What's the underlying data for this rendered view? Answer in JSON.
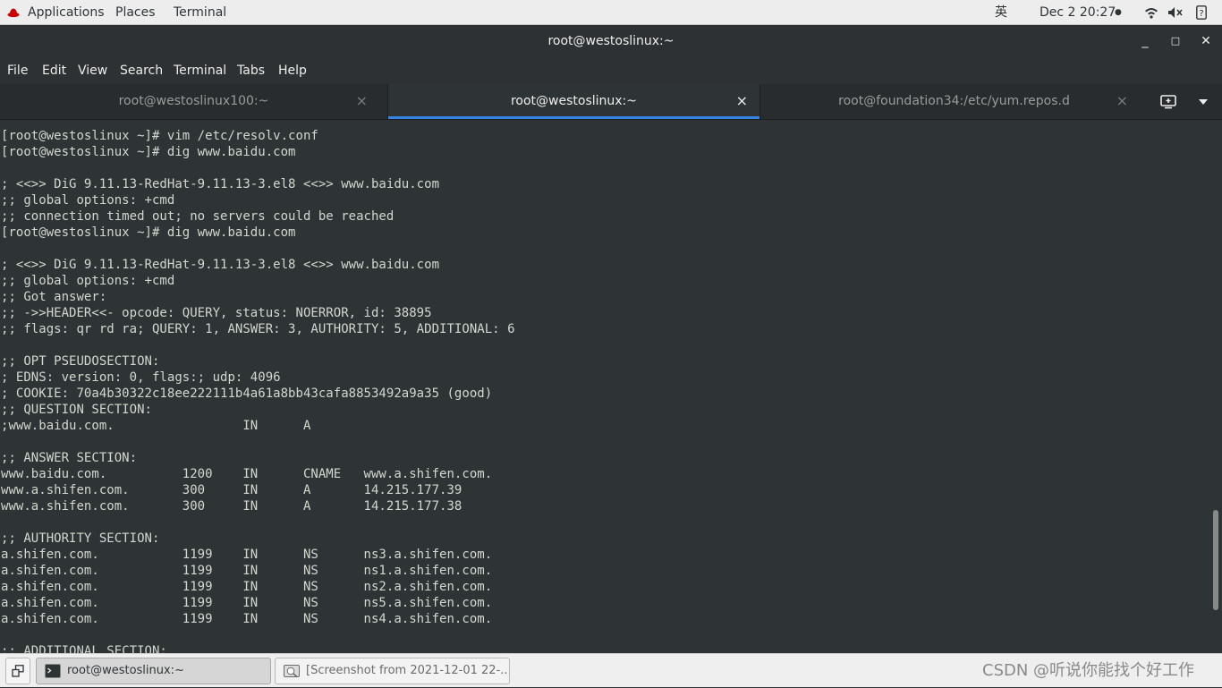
{
  "top_panel": {
    "applications": "Applications",
    "places": "Places",
    "terminal": "Terminal",
    "input_method": "英",
    "clock": "Dec 2  20:27",
    "icons": [
      "redhat-icon",
      "wifi-icon",
      "volume-icon",
      "power-icon"
    ]
  },
  "window": {
    "title": "root@westoslinux:~",
    "minimize": "_",
    "maximize": "□",
    "close": "✕"
  },
  "menu": {
    "file": "File",
    "edit": "Edit",
    "view": "View",
    "search": "Search",
    "terminal": "Terminal",
    "tabs": "Tabs",
    "help": "Help"
  },
  "tabs": [
    {
      "label": "root@westoslinux100:~",
      "active": false
    },
    {
      "label": "root@westoslinux:~",
      "active": true
    },
    {
      "label": "root@foundation34:/etc/yum.repos.d",
      "active": false
    }
  ],
  "tab_close": "×",
  "terminal_lines": [
    "[root@westoslinux ~]# vim /etc/resolv.conf",
    "[root@westoslinux ~]# dig www.baidu.com",
    "",
    "; <<>> DiG 9.11.13-RedHat-9.11.13-3.el8 <<>> www.baidu.com",
    ";; global options: +cmd",
    ";; connection timed out; no servers could be reached",
    "[root@westoslinux ~]# dig www.baidu.com",
    "",
    "; <<>> DiG 9.11.13-RedHat-9.11.13-3.el8 <<>> www.baidu.com",
    ";; global options: +cmd",
    ";; Got answer:",
    ";; ->>HEADER<<- opcode: QUERY, status: NOERROR, id: 38895",
    ";; flags: qr rd ra; QUERY: 1, ANSWER: 3, AUTHORITY: 5, ADDITIONAL: 6",
    "",
    ";; OPT PSEUDOSECTION:",
    "; EDNS: version: 0, flags:; udp: 4096",
    "; COOKIE: 70a4b30322c18ee222111b4a61a8bb43cafa8853492a9a35 (good)",
    ";; QUESTION SECTION:",
    ";www.baidu.com.                 IN      A",
    "",
    ";; ANSWER SECTION:",
    "www.baidu.com.          1200    IN      CNAME   www.a.shifen.com.",
    "www.a.shifen.com.       300     IN      A       14.215.177.39",
    "www.a.shifen.com.       300     IN      A       14.215.177.38",
    "",
    ";; AUTHORITY SECTION:",
    "a.shifen.com.           1199    IN      NS      ns3.a.shifen.com.",
    "a.shifen.com.           1199    IN      NS      ns1.a.shifen.com.",
    "a.shifen.com.           1199    IN      NS      ns2.a.shifen.com.",
    "a.shifen.com.           1199    IN      NS      ns5.a.shifen.com.",
    "a.shifen.com.           1199    IN      NS      ns4.a.shifen.com.",
    "",
    ";; ADDITIONAL SECTION:"
  ],
  "taskbar": {
    "terminal_task": "root@westoslinux:~",
    "screenshot_task": "[Screenshot from 2021-12-01 22-...",
    "watermark": "CSDN @听说你能找个好工作"
  }
}
